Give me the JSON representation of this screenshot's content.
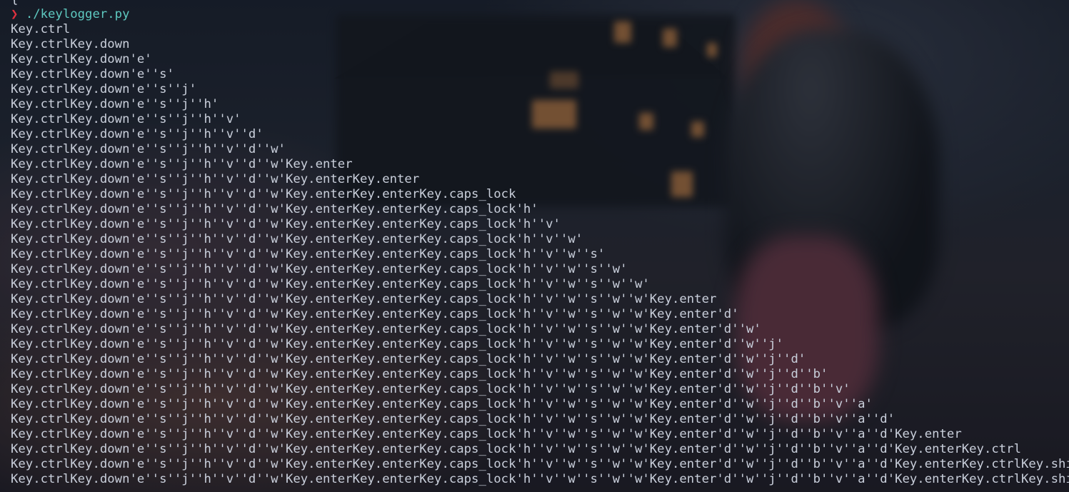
{
  "terminal": {
    "prev_fragment": "{",
    "prompt_symbol": "❯",
    "command": "./keylogger.py",
    "output_lines": [
      "Key.ctrl",
      "Key.ctrlKey.down",
      "Key.ctrlKey.down'e'",
      "Key.ctrlKey.down'e''s'",
      "Key.ctrlKey.down'e''s''j'",
      "Key.ctrlKey.down'e''s''j''h'",
      "Key.ctrlKey.down'e''s''j''h''v'",
      "Key.ctrlKey.down'e''s''j''h''v''d'",
      "Key.ctrlKey.down'e''s''j''h''v''d''w'",
      "Key.ctrlKey.down'e''s''j''h''v''d''w'Key.enter",
      "Key.ctrlKey.down'e''s''j''h''v''d''w'Key.enterKey.enter",
      "Key.ctrlKey.down'e''s''j''h''v''d''w'Key.enterKey.enterKey.caps_lock",
      "Key.ctrlKey.down'e''s''j''h''v''d''w'Key.enterKey.enterKey.caps_lock'h'",
      "Key.ctrlKey.down'e''s''j''h''v''d''w'Key.enterKey.enterKey.caps_lock'h''v'",
      "Key.ctrlKey.down'e''s''j''h''v''d''w'Key.enterKey.enterKey.caps_lock'h''v''w'",
      "Key.ctrlKey.down'e''s''j''h''v''d''w'Key.enterKey.enterKey.caps_lock'h''v''w''s'",
      "Key.ctrlKey.down'e''s''j''h''v''d''w'Key.enterKey.enterKey.caps_lock'h''v''w''s''w'",
      "Key.ctrlKey.down'e''s''j''h''v''d''w'Key.enterKey.enterKey.caps_lock'h''v''w''s''w''w'",
      "Key.ctrlKey.down'e''s''j''h''v''d''w'Key.enterKey.enterKey.caps_lock'h''v''w''s''w''w'Key.enter",
      "Key.ctrlKey.down'e''s''j''h''v''d''w'Key.enterKey.enterKey.caps_lock'h''v''w''s''w''w'Key.enter'd'",
      "Key.ctrlKey.down'e''s''j''h''v''d''w'Key.enterKey.enterKey.caps_lock'h''v''w''s''w''w'Key.enter'd''w'",
      "Key.ctrlKey.down'e''s''j''h''v''d''w'Key.enterKey.enterKey.caps_lock'h''v''w''s''w''w'Key.enter'd''w''j'",
      "Key.ctrlKey.down'e''s''j''h''v''d''w'Key.enterKey.enterKey.caps_lock'h''v''w''s''w''w'Key.enter'd''w''j''d'",
      "Key.ctrlKey.down'e''s''j''h''v''d''w'Key.enterKey.enterKey.caps_lock'h''v''w''s''w''w'Key.enter'd''w''j''d''b'",
      "Key.ctrlKey.down'e''s''j''h''v''d''w'Key.enterKey.enterKey.caps_lock'h''v''w''s''w''w'Key.enter'd''w''j''d''b''v'",
      "Key.ctrlKey.down'e''s''j''h''v''d''w'Key.enterKey.enterKey.caps_lock'h''v''w''s''w''w'Key.enter'd''w''j''d''b''v''a'",
      "Key.ctrlKey.down'e''s''j''h''v''d''w'Key.enterKey.enterKey.caps_lock'h''v''w''s''w''w'Key.enter'd''w''j''d''b''v''a''d'",
      "Key.ctrlKey.down'e''s''j''h''v''d''w'Key.enterKey.enterKey.caps_lock'h''v''w''s''w''w'Key.enter'd''w''j''d''b''v''a''d'Key.enter",
      "Key.ctrlKey.down'e''s''j''h''v''d''w'Key.enterKey.enterKey.caps_lock'h''v''w''s''w''w'Key.enter'd''w''j''d''b''v''a''d'Key.enterKey.ctrl",
      "Key.ctrlKey.down'e''s''j''h''v''d''w'Key.enterKey.enterKey.caps_lock'h''v''w''s''w''w'Key.enter'd''w''j''d''b''v''a''d'Key.enterKey.ctrlKey.shift",
      "Key.ctrlKey.down'e''s''j''h''v''d''w'Key.enterKey.enterKey.caps_lock'h''v''w''s''w''w'Key.enter'd''w''j''d''b''v''a''d'Key.enterKey.ctrlKey.shift'Z'"
    ]
  },
  "colors": {
    "background": "#141a24",
    "text": "#c9cfdb",
    "prompt_symbol": "#e0313f",
    "command": "#5ec9c0"
  }
}
